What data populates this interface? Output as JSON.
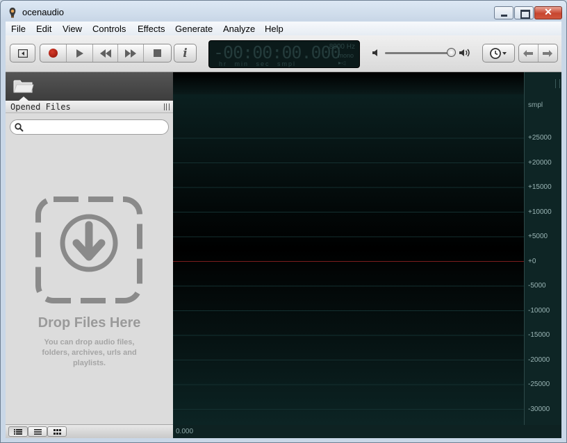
{
  "window": {
    "title": "ocenaudio"
  },
  "menu": [
    "File",
    "Edit",
    "View",
    "Controls",
    "Effects",
    "Generate",
    "Analyze",
    "Help"
  ],
  "display": {
    "time": "-00:00:00.000",
    "sample_rate": "8000 Hz",
    "channels": "mono",
    "units": "hr min sec smpl",
    "extra": "▸◁"
  },
  "volume": {
    "level": 0.95
  },
  "sidebar": {
    "section_label": "Opened Files",
    "search_placeholder": "",
    "drop_title": "Drop Files Here",
    "drop_description": "You can drop audio files, folders, archives, urls and playlists."
  },
  "waveform": {
    "time_start": "0.000",
    "ruler_unit": "smpl",
    "ticks": [
      "+25000",
      "+20000",
      "+15000",
      "+10000",
      "+5000",
      "+0",
      "-5000",
      "-10000",
      "-15000",
      "-20000",
      "-25000",
      "-30000"
    ]
  },
  "colors": {
    "wave_bg": "#000000",
    "zero_line": "#7a1e1e",
    "ruler_text": "#9ab5b5"
  }
}
